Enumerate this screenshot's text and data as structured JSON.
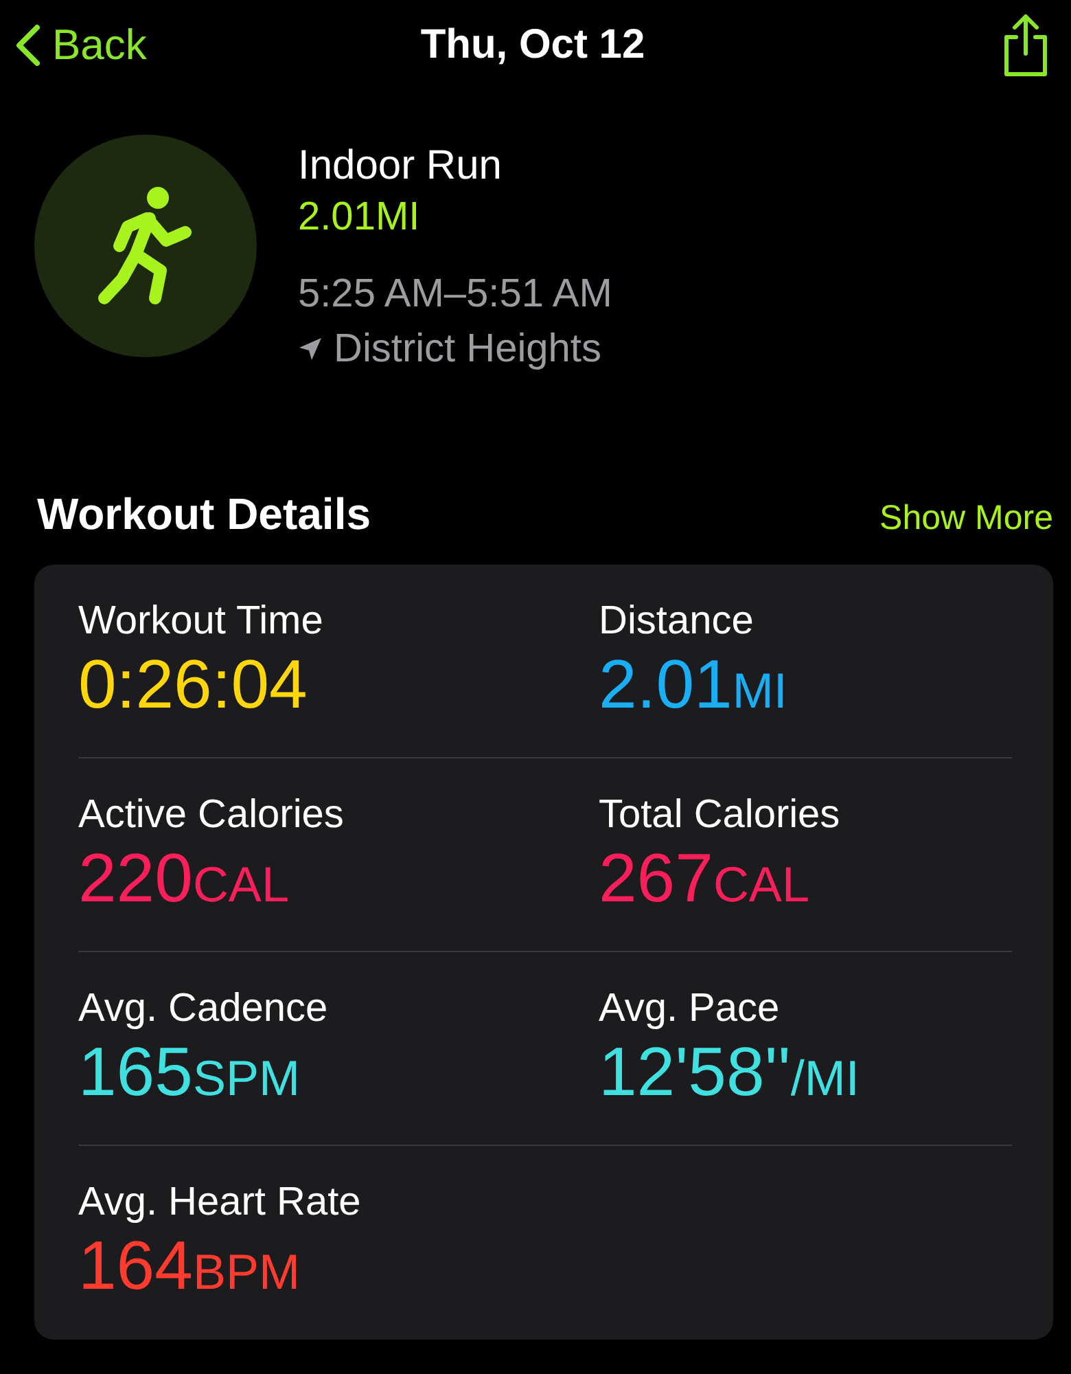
{
  "nav": {
    "back": "Back",
    "title": "Thu, Oct 12"
  },
  "workout": {
    "name": "Indoor Run",
    "distance": "2.01MI",
    "time_range": "5:25 AM–5:51 AM",
    "location": "District Heights"
  },
  "section": {
    "title": "Workout Details",
    "action": "Show More"
  },
  "metrics": [
    {
      "label": "Workout Time",
      "value": "0:26:04",
      "color": "#ffd60a"
    },
    {
      "label": "Distance",
      "value": "2.01",
      "unit": "MI",
      "color": "#1aaef5"
    },
    {
      "label": "Active Calories",
      "value": "220",
      "unit": "CAL",
      "color": "#fa1e5a"
    },
    {
      "label": "Total Calories",
      "value": "267",
      "unit": "CAL",
      "color": "#fa1e5a"
    },
    {
      "label": "Avg. Cadence",
      "value": "165",
      "unit": "SPM",
      "color": "#40dfe0"
    },
    {
      "label": "Avg. Pace",
      "value": "12'58''",
      "unit": "/MI",
      "color": "#40dfe0"
    },
    {
      "label": "Avg. Heart Rate",
      "value": "164",
      "unit": "BPM",
      "color": "#ff3b2f"
    }
  ]
}
